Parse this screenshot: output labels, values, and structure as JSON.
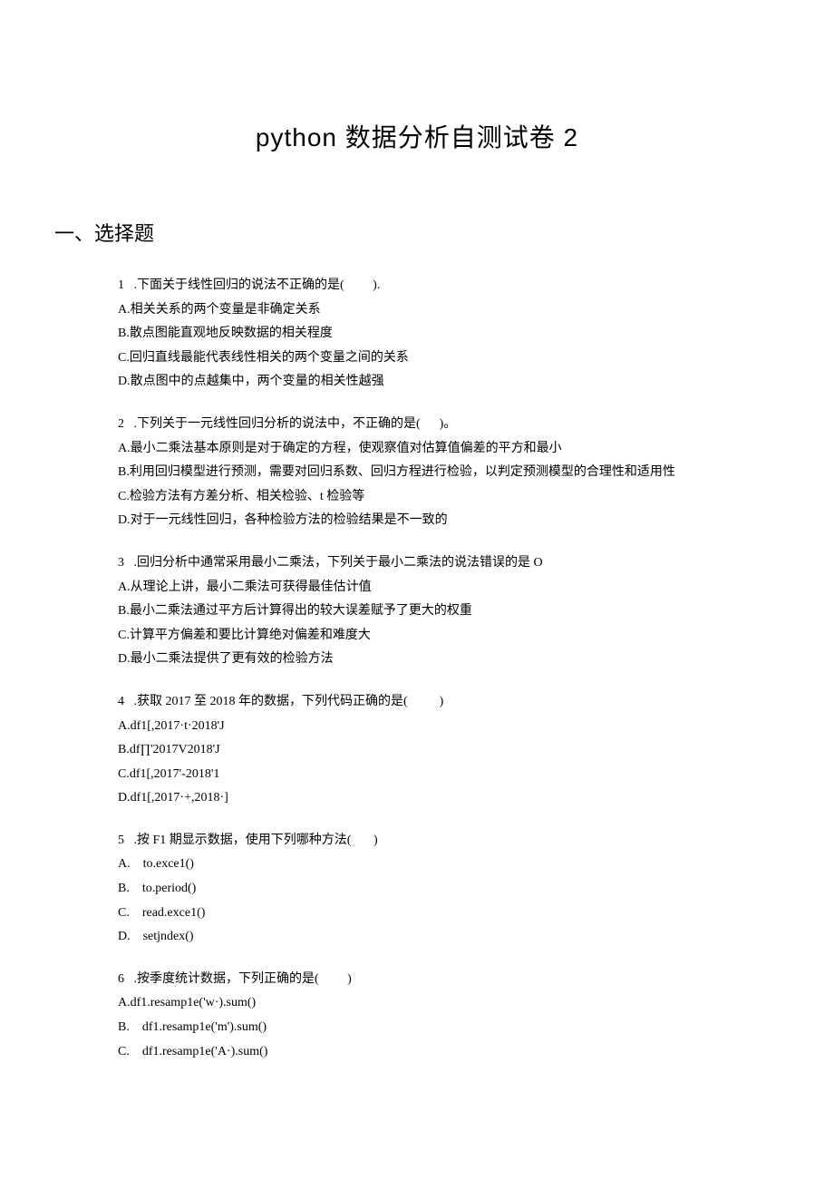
{
  "title": "python 数据分析自测试卷 2",
  "section": "一、选择题",
  "q1": {
    "stem": "1   .下面关于线性回归的说法不正确的是(         ).",
    "a": "A.相关关系的两个变量是非确定关系",
    "b": "B.散点图能直观地反映数据的相关程度",
    "c": "C.回归直线最能代表线性相关的两个变量之间的关系",
    "d": "D.散点图中的点越集中，两个变量的相关性越强"
  },
  "q2": {
    "stem": "2   .下列关于一元线性回归分析的说法中，不正确的是(      )。",
    "a": "A.最小二乘法基本原则是对于确定的方程，使观察值对估算值偏差的平方和最小",
    "b": "B.利用回归模型进行预测，需要对回归系数、回归方程进行检验，以判定预测模型的合理性和适用性",
    "c": "C.检验方法有方差分析、相关检验、t 检验等",
    "d": "D.对于一元线性回归，各种检验方法的检验结果是不一致的"
  },
  "q3": {
    "stem": "3   .回归分析中通常采用最小二乘法，下列关于最小二乘法的说法错误的是 O",
    "a": "A.从理论上讲，最小二乘法可获得最佳估计值",
    "b": "B.最小二乘法通过平方后计算得出的较大误差赋予了更大的权重",
    "c": "C.计算平方偏差和要比计算绝对偏差和难度大",
    "d": "D.最小二乘法提供了更有效的检验方法"
  },
  "q4": {
    "stem": "4   .获取 2017 至 2018 年的数据，下列代码正确的是(          )",
    "a": "A.df1[,2017·t·2018'J",
    "b": "B.df∏'2017V2018'J",
    "c": "C.df1[,2017'-2018'1",
    "d": "D.df1[,2017·+,2018·]"
  },
  "q5": {
    "stem": "5   .按 F1 期显示数据，使用下列哪种方法(       )",
    "a": "A.    to.exce1()",
    "b": "B.    to.period()",
    "c": "C.    read.exce1()",
    "d": "D.    setjndex()"
  },
  "q6": {
    "stem": "6   .按季度统计数据，下列正确的是(         )",
    "a": "A.df1.resamp1e('w·).sum()",
    "b": "B.    df1.resamp1e('m').sum()",
    "c": "C.    df1.resamp1e('A·).sum()"
  }
}
